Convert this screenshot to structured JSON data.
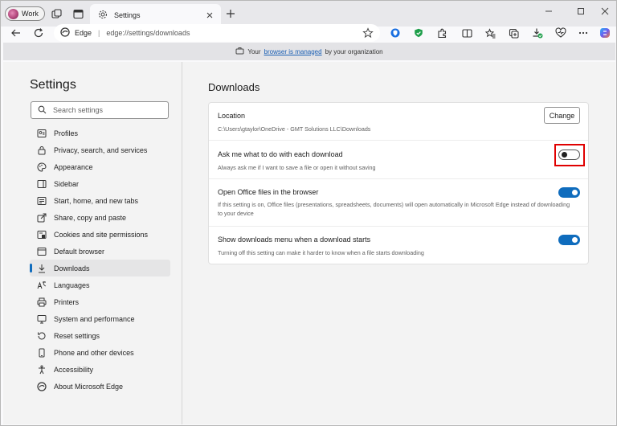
{
  "browser": {
    "profile_label": "Work",
    "tab_title": "Settings",
    "address_brand": "Edge",
    "address_url": "edge://settings/downloads",
    "managed_prefix": "Your",
    "managed_link": "browser is managed",
    "managed_suffix": "by your organization"
  },
  "sidebar": {
    "title": "Settings",
    "search_placeholder": "Search settings",
    "items": [
      {
        "label": "Profiles",
        "icon": "profile-icon"
      },
      {
        "label": "Privacy, search, and services",
        "icon": "lock-icon"
      },
      {
        "label": "Appearance",
        "icon": "palette-icon"
      },
      {
        "label": "Sidebar",
        "icon": "sidebar-icon"
      },
      {
        "label": "Start, home, and new tabs",
        "icon": "home-icon"
      },
      {
        "label": "Share, copy and paste",
        "icon": "share-icon"
      },
      {
        "label": "Cookies and site permissions",
        "icon": "cookie-icon"
      },
      {
        "label": "Default browser",
        "icon": "browser-icon"
      },
      {
        "label": "Downloads",
        "icon": "download-icon",
        "active": true
      },
      {
        "label": "Languages",
        "icon": "language-icon"
      },
      {
        "label": "Printers",
        "icon": "printer-icon"
      },
      {
        "label": "System and performance",
        "icon": "system-icon"
      },
      {
        "label": "Reset settings",
        "icon": "reset-icon"
      },
      {
        "label": "Phone and other devices",
        "icon": "phone-icon"
      },
      {
        "label": "Accessibility",
        "icon": "accessibility-icon"
      },
      {
        "label": "About Microsoft Edge",
        "icon": "edge-icon"
      }
    ]
  },
  "downloads": {
    "title": "Downloads",
    "location_title": "Location",
    "location_path": "C:\\Users\\gtaylor\\OneDrive - GMT Solutions LLC\\Downloads",
    "change_label": "Change",
    "ask_title": "Ask me what to do with each download",
    "ask_desc": "Always ask me if I want to save a file or open it without saving",
    "ask_enabled": false,
    "office_title": "Open Office files in the browser",
    "office_desc": "If this setting is on, Office files (presentations, spreadsheets, documents) will open automatically in Microsoft Edge instead of downloading to your device",
    "office_enabled": true,
    "menu_title": "Show downloads menu when a download starts",
    "menu_desc": "Turning off this setting can make it harder to know when a file starts downloading",
    "menu_enabled": true
  },
  "colors": {
    "accent": "#0f6cbd",
    "highlight": "#e00000"
  }
}
